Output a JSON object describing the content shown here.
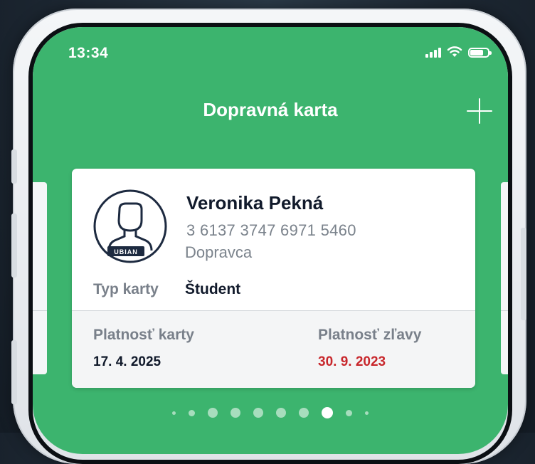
{
  "status_bar": {
    "time": "13:34"
  },
  "header": {
    "title": "Dopravná karta",
    "add_icon": "plus-icon"
  },
  "card": {
    "avatar_brand": "UBIAN",
    "holder_name": "Veronika Pekná",
    "card_number": "3 6137 3747 6971 5460",
    "carrier": "Dopravca",
    "type_label": "Typ karty",
    "type_value": "Študent",
    "validity_label": "Platnosť karty",
    "validity_value": "17. 4. 2025",
    "discount_label": "Platnosť zľavy",
    "discount_value": "30. 9. 2023",
    "discount_color": "#c8272c"
  },
  "pager": {
    "count": 10,
    "active_index": 7
  },
  "colors": {
    "accent": "#3cb46e",
    "frame": "#e6e9ec"
  }
}
